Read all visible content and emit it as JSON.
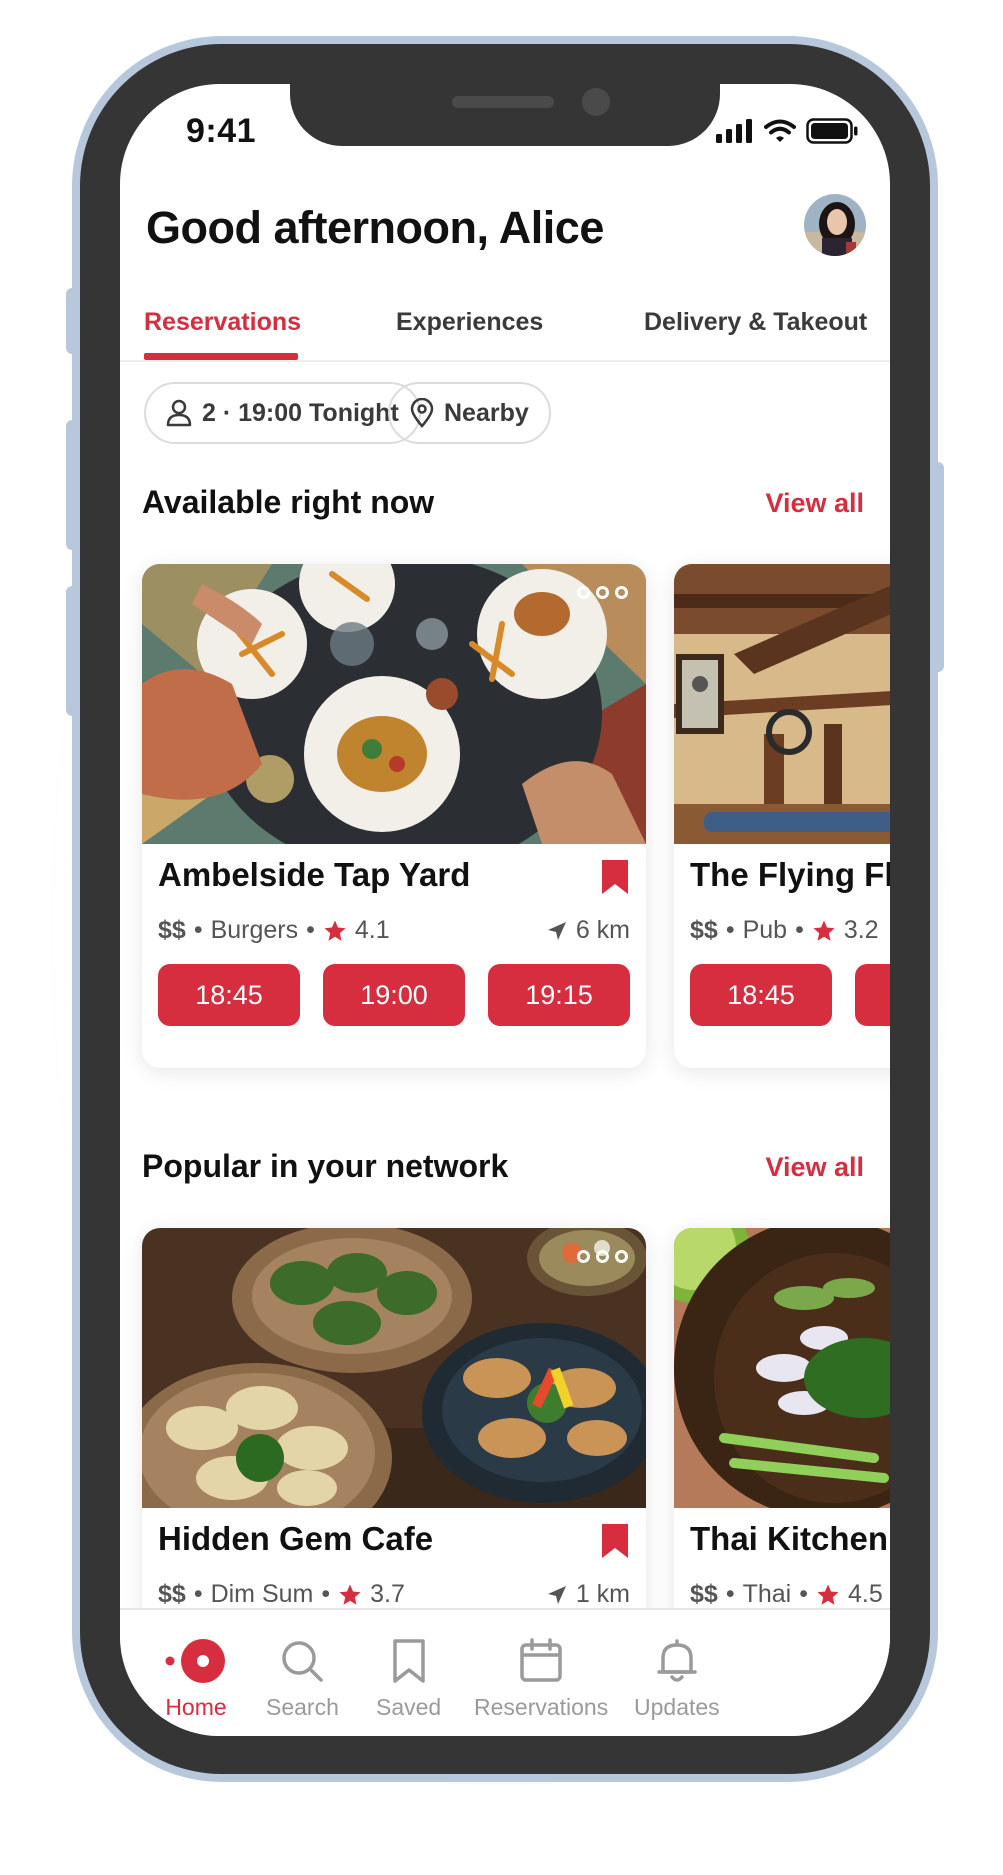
{
  "status_bar": {
    "time": "9:41"
  },
  "header": {
    "greeting": "Good afternoon, Alice"
  },
  "tabs": [
    {
      "label": "Reservations",
      "active": true
    },
    {
      "label": "Experiences",
      "active": false
    },
    {
      "label": "Delivery & Takeout",
      "active": false
    }
  ],
  "filters": {
    "party": "2 · 19:00 Tonight",
    "location": "Nearby"
  },
  "sections": {
    "available": {
      "title": "Available right now",
      "view_all": "View all"
    },
    "popular": {
      "title": "Popular in your network",
      "view_all": "View all"
    }
  },
  "available_cards": [
    {
      "name": "Ambelside Tap Yard",
      "price": "$$",
      "cuisine": "Burgers",
      "rating": "4.1",
      "distance": "6 km",
      "times": [
        "18:45",
        "19:00",
        "19:15"
      ]
    },
    {
      "name": "The Flying Fl",
      "price": "$$",
      "cuisine": "Pub",
      "rating": "3.2",
      "times": [
        "18:45"
      ]
    }
  ],
  "popular_cards": [
    {
      "name": "Hidden Gem Cafe",
      "price": "$$",
      "cuisine": "Dim Sum",
      "rating": "3.7",
      "distance": "1 km"
    },
    {
      "name": "Thai Kitchen",
      "price": "$$",
      "cuisine": "Thai",
      "rating": "4.5"
    }
  ],
  "bottom_nav": [
    {
      "label": "Home",
      "icon": "home-icon",
      "active": true
    },
    {
      "label": "Search",
      "icon": "search-icon",
      "active": false
    },
    {
      "label": "Saved",
      "icon": "bookmark-icon",
      "active": false
    },
    {
      "label": "Reservations",
      "icon": "calendar-icon",
      "active": false
    },
    {
      "label": "Updates",
      "icon": "bell-icon",
      "active": false
    }
  ],
  "colors": {
    "accent": "#d62d3f",
    "text": "#111111",
    "muted": "#9a9a9a",
    "frame": "#353535",
    "frame_edge": "#b7c8dc"
  }
}
